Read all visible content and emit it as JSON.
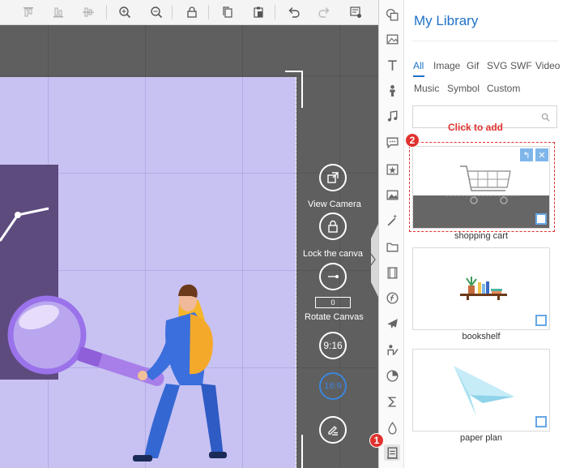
{
  "toolbar": {
    "icons": [
      "align-top-icon",
      "align-middle-icon",
      "align-bottom-icon",
      "zoom-in-icon",
      "zoom-out-icon",
      "lock-icon",
      "copy-icon",
      "paste-icon",
      "undo-icon",
      "redo-icon",
      "screen-settings-icon"
    ]
  },
  "canvas_controls": {
    "view_camera": "View Camera",
    "lock_canvas": "Lock the canva",
    "rotate_canvas": "Rotate Canvas",
    "rotate_value": "0",
    "ratio_916": "9:16",
    "ratio_169": "16:9"
  },
  "library": {
    "title": "My Library",
    "tabs": [
      "All",
      "Image",
      "Gif",
      "SVG",
      "SWF",
      "Video",
      "Music",
      "Symbol",
      "Custom"
    ],
    "active_tab": "All",
    "click_to_add": "Click to add",
    "items": [
      {
        "label": "shopping cart"
      },
      {
        "label": "bookshelf"
      },
      {
        "label": "paper plan"
      }
    ]
  },
  "badges": {
    "one": "1",
    "two": "2"
  },
  "colors": {
    "accent": "#1f72c7",
    "highlight": "#e0322e",
    "artboard": "#c8c2f3",
    "canvas": "#5f5f5f"
  }
}
